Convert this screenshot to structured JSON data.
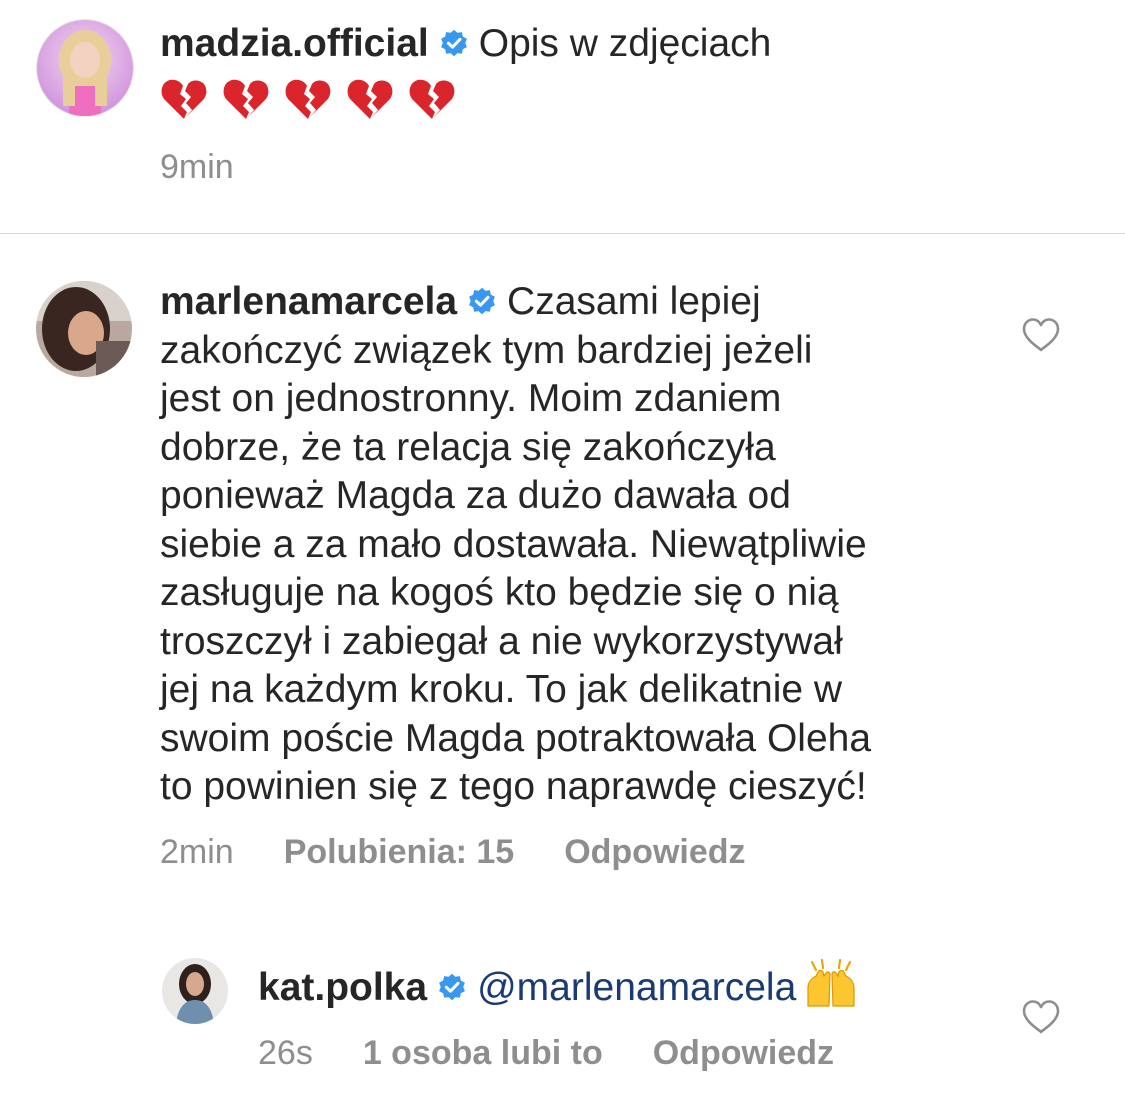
{
  "caption": {
    "username": "madzia.official",
    "text": "Opis w zdjęciach",
    "emojis": [
      "💔",
      "💔",
      "💔",
      "💔",
      "💔"
    ],
    "time": "9min"
  },
  "comments": [
    {
      "username": "marlenamarcela",
      "lines": [
        "Czasami lepiej",
        "zakończyć związek tym bardziej jeżeli",
        "jest on jednostronny.  Moim zdaniem",
        "dobrze,  że ta relacja się zakończyła",
        "ponieważ Magda za dużo dawała od",
        "siebie a za mało dostawała. Niewątpliwie",
        "zasługuje na kogoś kto będzie się o nią",
        "troszczył i zabiegał a nie wykorzystywał",
        "jej na każdym kroku. To jak delikatnie w",
        "swoim poście Magda potraktowała Oleha",
        "to powinien się z tego naprawdę cieszyć!"
      ],
      "time": "2min",
      "likes": "Polubienia: 15",
      "reply": "Odpowiedz"
    }
  ],
  "reply": {
    "username": "kat.polka",
    "mention": "@marlenamarcela",
    "emoji": "🙌",
    "time": "26s",
    "likes": "1 osoba lubi to",
    "reply": "Odpowiedz"
  },
  "icons": {
    "verified": "verified-badge-icon",
    "heart": "heart-outline-icon"
  },
  "colors": {
    "verified_blue": "#3897f0",
    "meta_gray": "#8e8e8e",
    "text": "#262626",
    "mention": "#1a3a73"
  }
}
